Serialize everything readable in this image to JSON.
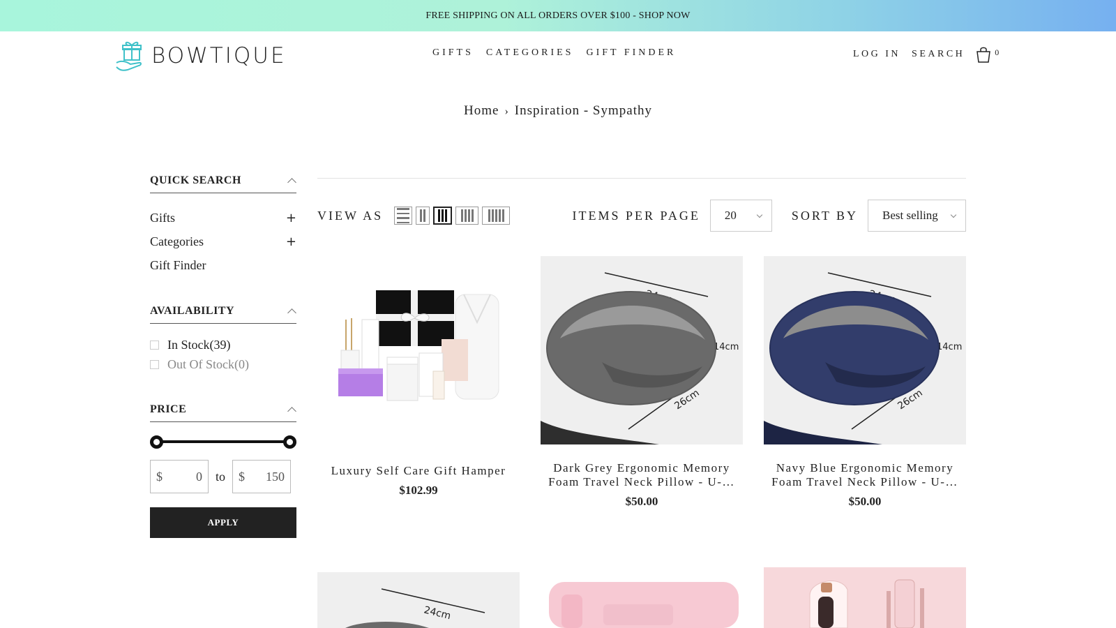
{
  "announcement": "FREE SHIPPING ON ALL ORDERS OVER $100 - SHOP NOW",
  "logo": "BOWTIQUE",
  "nav": [
    "GIFTS",
    "CATEGORIES",
    "GIFT FINDER"
  ],
  "header": {
    "login": "LOG IN",
    "search": "SEARCH",
    "cart_count": "0"
  },
  "breadcrumb": {
    "home": "Home",
    "sep": "›",
    "current": "Inspiration - Sympathy"
  },
  "sidebar": {
    "quick_search": {
      "title": "QUICK SEARCH",
      "items": [
        {
          "label": "Gifts",
          "expand": "+"
        },
        {
          "label": "Categories",
          "expand": "+"
        },
        {
          "label": "Gift Finder"
        }
      ]
    },
    "availability": {
      "title": "AVAILABILITY",
      "options": [
        {
          "label": "In Stock",
          "count": "(39)"
        },
        {
          "label": "Out Of Stock",
          "count": "(0)"
        }
      ]
    },
    "price": {
      "title": "PRICE",
      "currency": "$",
      "min": "0",
      "max": "150",
      "to": "to",
      "apply": "APPLY"
    }
  },
  "toolbar": {
    "view_as": "VIEW AS",
    "items_per_page_label": "ITEMS PER PAGE",
    "items_per_page_value": "20",
    "sort_by_label": "SORT BY",
    "sort_by_value": "Best selling"
  },
  "products": [
    {
      "name": "Luxury Self Care Gift Hamper",
      "price": "$102.99"
    },
    {
      "name": "Dark Grey Ergonomic Memory Foam Travel Neck Pillow - U-…",
      "price": "$50.00",
      "dim1": "24cm",
      "dim2": "14cm",
      "dim3": "26cm"
    },
    {
      "name": "Navy Blue Ergonomic Memory Foam Travel Neck Pillow - U-…",
      "price": "$50.00",
      "dim1": "24cm",
      "dim2": "14cm",
      "dim3": "26cm"
    },
    {
      "dim1": "24cm"
    }
  ],
  "colors": {
    "announce_start": "#a8f5dc",
    "announce_end": "#76b0f0",
    "logo_accent": "#3fc1c9",
    "apply_bg": "#222222"
  }
}
